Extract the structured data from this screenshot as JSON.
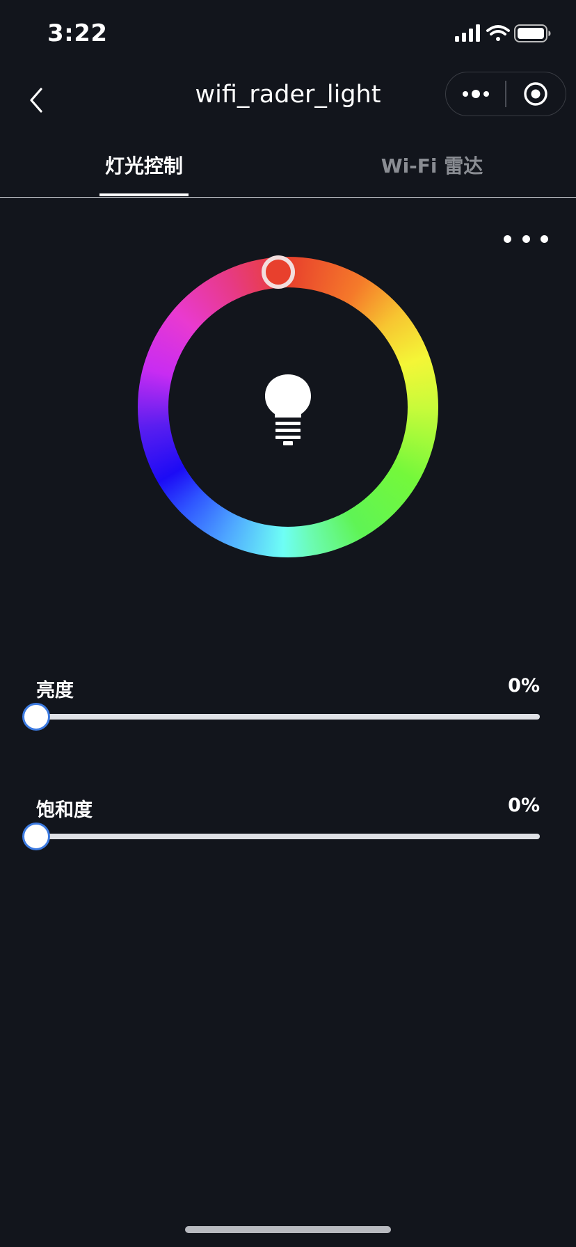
{
  "status_bar": {
    "time": "3:22",
    "icons": [
      "cellular-signal-icon",
      "wifi-icon",
      "battery-icon"
    ]
  },
  "nav": {
    "title": "wifi_rader_light",
    "back_icon": "chevron-left-icon",
    "capsule": [
      "more-dots-icon",
      "record-target-icon"
    ]
  },
  "tabs": [
    {
      "label": "灯光控制",
      "active": true
    },
    {
      "label": "Wi-Fi 雷达",
      "active": false
    }
  ],
  "colors": {
    "background": "#12151c",
    "selected_hue": "#e8402d",
    "slider_thumb_border": "#3c7ae0",
    "inactive_tab": "#8a8d93"
  },
  "color_wheel": {
    "center_icon": "light-bulb-icon",
    "hue_deg": 355
  },
  "sliders": {
    "brightness": {
      "label": "亮度",
      "value_text": "0%",
      "value": 0
    },
    "saturation": {
      "label": "饱和度",
      "value_text": "0%",
      "value": 0
    }
  }
}
